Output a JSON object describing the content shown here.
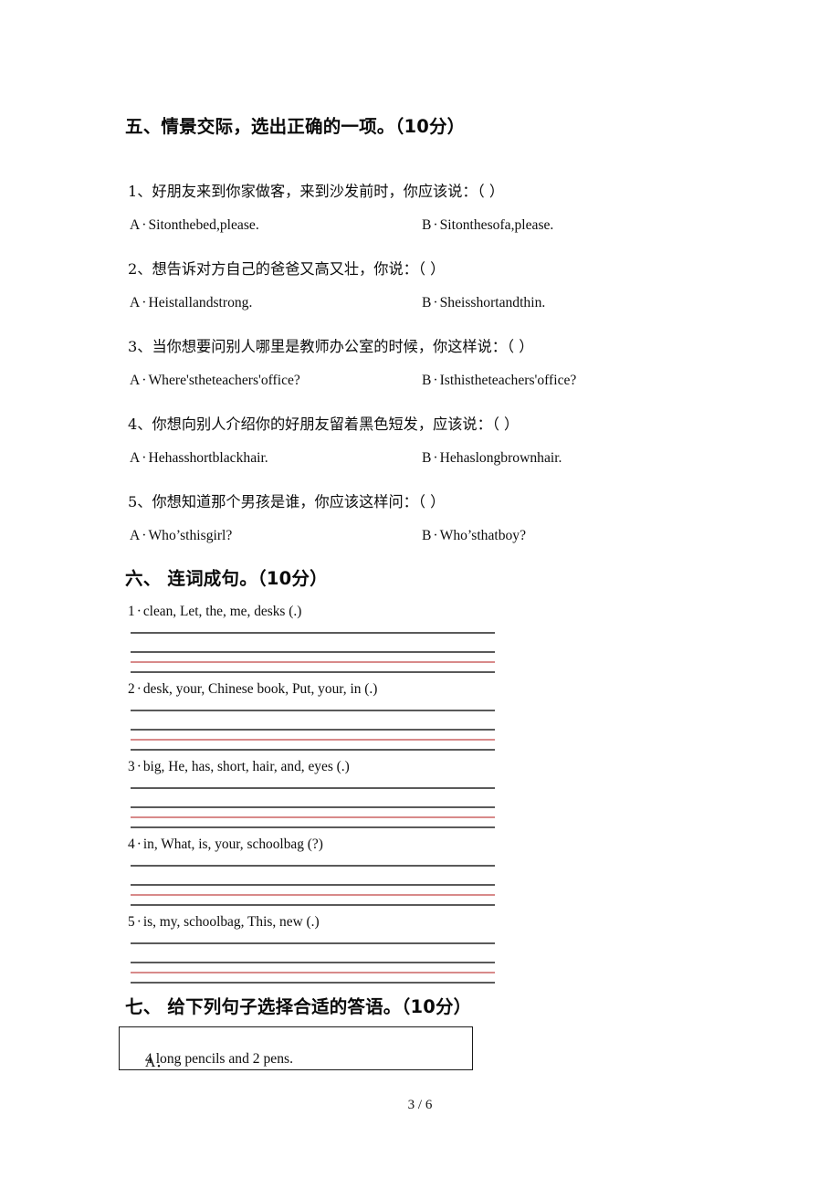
{
  "document": {
    "page_footer": "3 / 6"
  },
  "sections": [
    {
      "heading": "五、情景交际，选出正确的一项。（10分）",
      "questions": [
        {
          "stem": "1、好朋友来到你家做客，来到沙发前时，你应该说：（    ）",
          "option_a_letter": "A",
          "option_a_text": "Sitonthebed,please.",
          "option_b_letter": "B",
          "option_b_text": "Sitonthesofa,please."
        },
        {
          "stem": "2、想告诉对方自己的爸爸又高又壮，你说：（    ）",
          "option_a_letter": "A",
          "option_a_text": "Heistallandstrong.",
          "option_b_letter": "B",
          "option_b_text": "Sheisshortandthin."
        },
        {
          "stem": "3、当你想要问别人哪里是教师办公室的时候，你这样说：（    ）",
          "option_a_letter": "A",
          "option_a_text": "Where'stheteachers'office?",
          "option_b_letter": "B",
          "option_b_text": "Isthistheteachers'office?"
        },
        {
          "stem": "4、你想向别人介绍你的好朋友留着黑色短发，应该说：（    ）",
          "option_a_letter": "A",
          "option_a_text": "Hehasshortblackhair.",
          "option_b_letter": "B",
          "option_b_text": "Hehaslongbrownhair."
        },
        {
          "stem": "5、你想知道那个男孩是谁，你应该这样问：（    ）",
          "option_a_letter": "A",
          "option_a_text": "Who’sthisgirl?",
          "option_b_letter": "B",
          "option_b_text": "Who’sthatboy?"
        }
      ]
    },
    {
      "heading": "六、 连词成句。（10分）",
      "items": [
        {
          "number": "1",
          "text": "clean, Let, the, me, desks (.)"
        },
        {
          "number": "2",
          "text": "desk, your, Chinese book, Put, your, in (.)"
        },
        {
          "number": "3",
          "text": "big, He, has, short, hair, and, eyes (.)"
        },
        {
          "number": "4",
          "text": "in, What, is, your, schoolbag (?)"
        },
        {
          "number": "5",
          "text": "is, my, schoolbag, This, new (.)"
        }
      ]
    },
    {
      "heading": "七、 给下列句子选择合适的答语。（10分）",
      "answer_choices": [
        {
          "label": "A．",
          "text": "4 long pencils and 2 pens."
        }
      ]
    }
  ],
  "separator": "·",
  "colors": {
    "text": "#0d0d0d",
    "rule_dark": "#5a5a5a",
    "rule_red": "#d88a8a",
    "box_border": "#1a1a1a"
  }
}
